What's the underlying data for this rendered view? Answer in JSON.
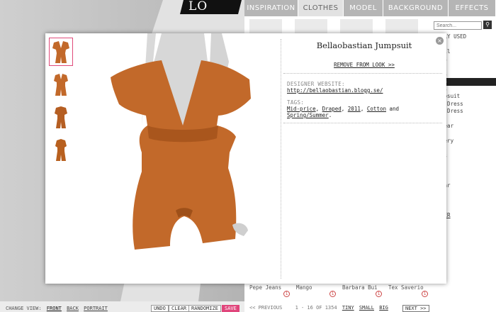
{
  "logo": "LO",
  "tabs": [
    {
      "label": "INSPIRATION",
      "active": false
    },
    {
      "label": "CLOTHES",
      "active": true
    },
    {
      "label": "MODEL",
      "active": false
    },
    {
      "label": "BACKGROUND",
      "active": false
    },
    {
      "label": "EFFECTS",
      "active": false
    }
  ],
  "search": {
    "placeholder": "Search..."
  },
  "categories": [
    {
      "label": "ENTLY USED",
      "active": false,
      "link": false
    },
    {
      "label": "E",
      "active": false,
      "link": true
    },
    {
      "label": "w all",
      "active": false,
      "link": false
    },
    {
      "label": "kets",
      "active": false,
      "link": false
    },
    {
      "label": "s",
      "active": false,
      "link": false
    },
    {
      "label": "toms",
      "active": false,
      "link": false
    },
    {
      "label": "sses",
      "active": true,
      "link": false
    },
    {
      "label": "ress",
      "active": false,
      "link": false
    },
    {
      "label": "Jumpsuit",
      "active": false,
      "link": false
    },
    {
      "label": "axi Dress",
      "active": false,
      "link": false
    },
    {
      "label": "ini Dress",
      "active": false,
      "link": false
    },
    {
      "label": "ts",
      "active": false,
      "link": false
    },
    {
      "label": "erwear",
      "active": false,
      "link": false
    },
    {
      "label": "ery",
      "active": false,
      "link": false
    },
    {
      "label": "ellery",
      "active": false,
      "link": false
    },
    {
      "label": "s",
      "active": false,
      "link": false
    },
    {
      "label": "rves",
      "active": false,
      "link": false
    },
    {
      "label": "ves",
      "active": false,
      "link": false
    },
    {
      "label": "s",
      "active": false,
      "link": false
    },
    {
      "label": "ts",
      "active": false,
      "link": false
    },
    {
      "label": "ewear",
      "active": false,
      "link": false
    },
    {
      "label": "es",
      "active": false,
      "link": false
    },
    {
      "label": "ras",
      "active": false,
      "link": false
    },
    {
      "label": "",
      "active": false,
      "link": false
    },
    {
      "label": "IGNER",
      "active": false,
      "link": true
    },
    {
      "label": "",
      "active": false,
      "link": false
    },
    {
      "label": "ER",
      "active": false,
      "link": true
    }
  ],
  "brands": [
    "Pepe Jeans",
    "Mango",
    "Barbara Bui",
    "Tex Saverio"
  ],
  "brand_badge": "1",
  "pager": {
    "previous": "<< PREVIOUS",
    "range": "1 - 16 OF 1354",
    "tiny": "TINY",
    "small": "SMALL",
    "big": "BIG",
    "next": "NEXT >>"
  },
  "change_view": {
    "label": "CHANGE VIEW:",
    "front": "FRONT",
    "back": "BACK",
    "portrait": "PORTRAIT"
  },
  "actions": {
    "undo": "UNDO",
    "clear": "CLEAR",
    "randomize": "RANDOMIZE",
    "save": "SAVE"
  },
  "modal": {
    "close": "×",
    "title": "Bellaobastian Jumpsuit",
    "remove": "REMOVE FROM LOOK >>",
    "website_label": "DESIGNER WEBSITE:",
    "website_url": "http://bellaobastian.blogg.se/",
    "tags_label": "TAGS:",
    "tags": [
      "Mid-price",
      "Draped",
      "2011",
      "Cotton"
    ],
    "tags_sep": ", ",
    "tags_and": "and",
    "tags_last": "Spring/Summer",
    "tags_end": "."
  },
  "colors": {
    "accent": "#e0457b",
    "jumpsuit": "#c2692a",
    "tab_bg": "#b5b5b5"
  }
}
